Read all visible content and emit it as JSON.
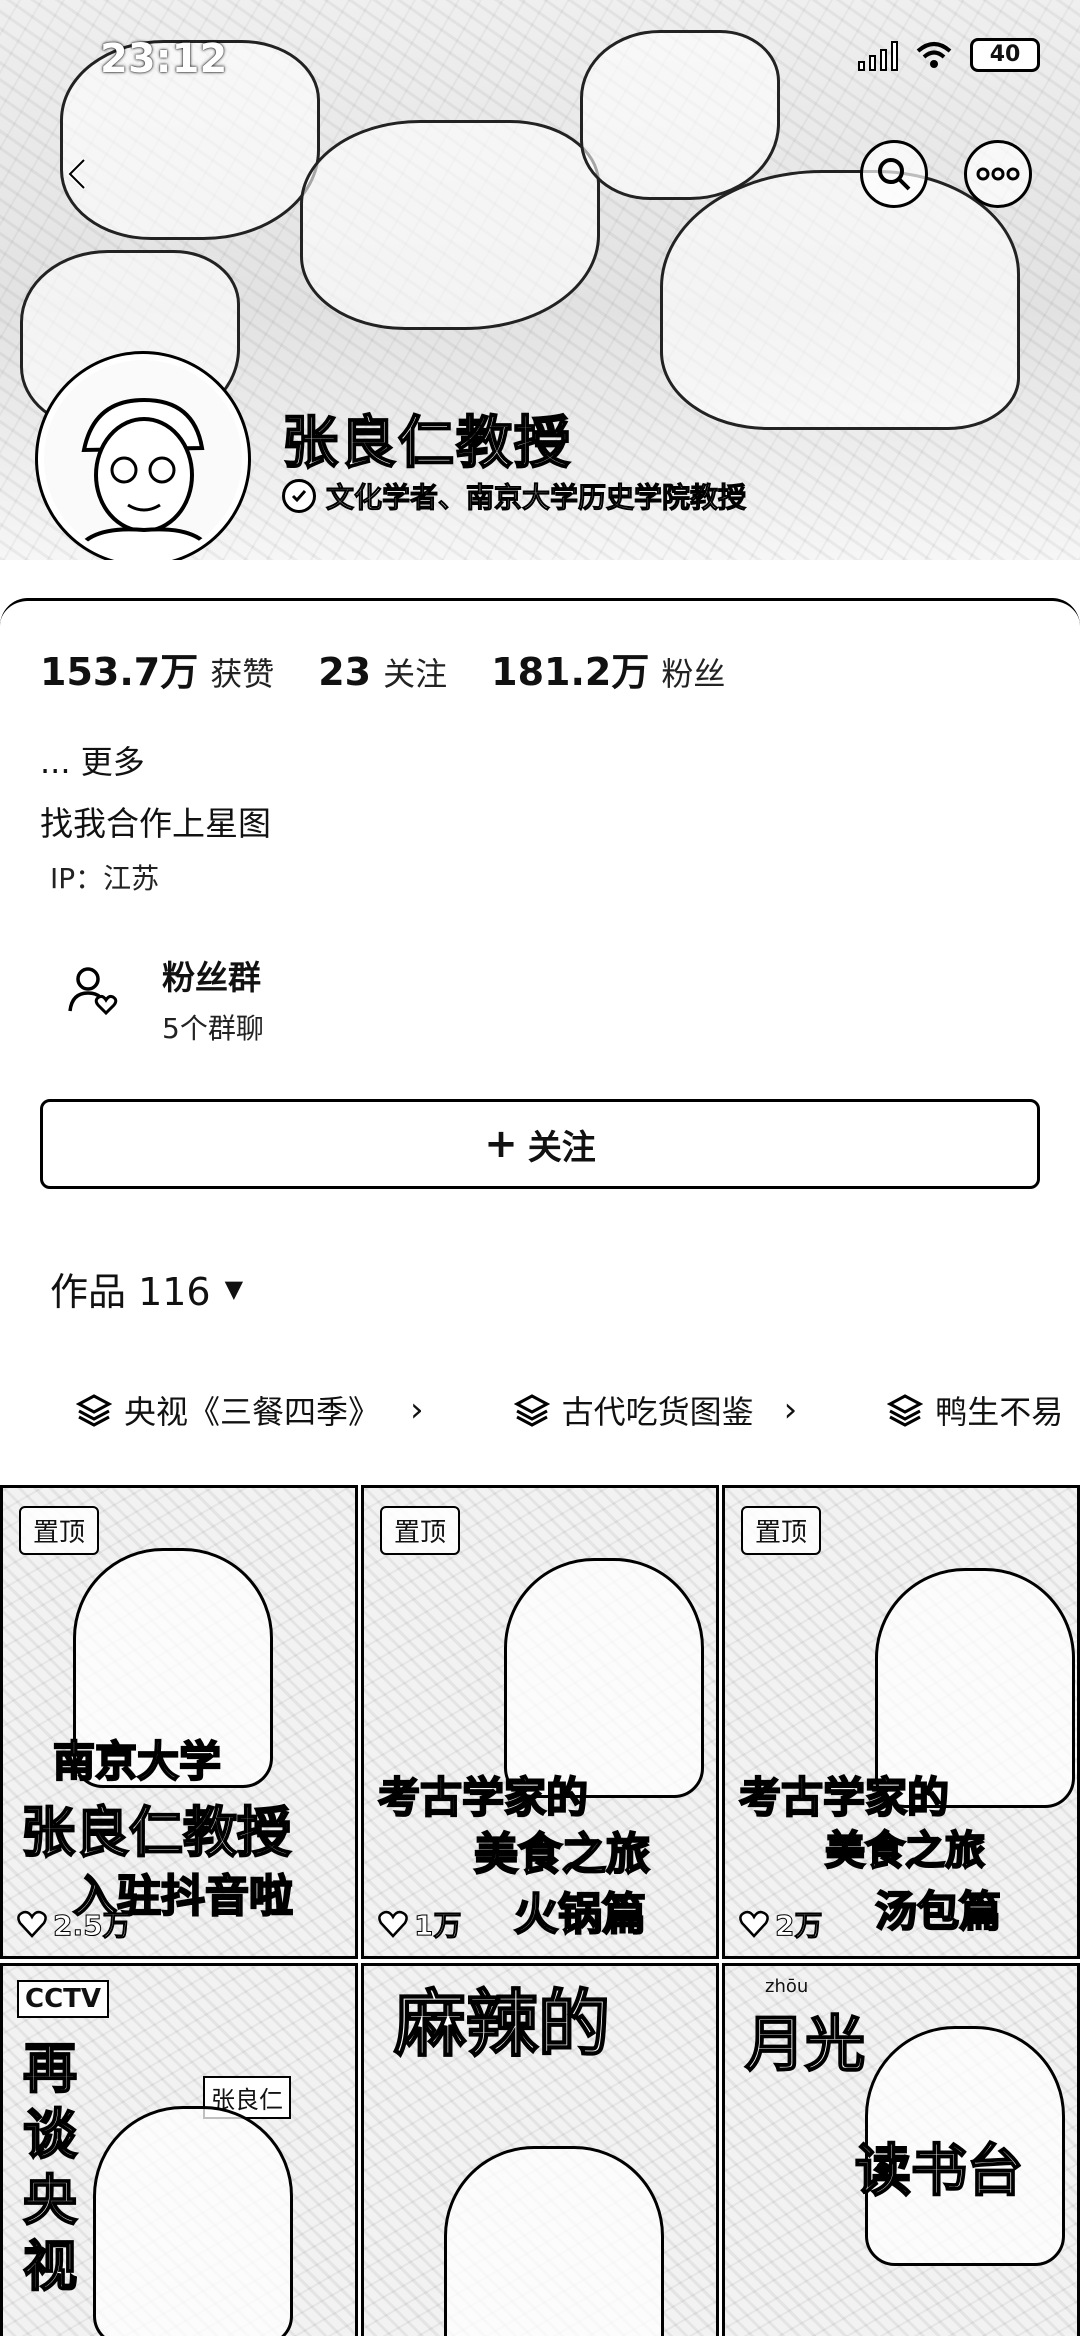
{
  "status_bar": {
    "time": "23:12",
    "battery": "40"
  },
  "profile": {
    "name": "张良仁教授",
    "verification": "文化学者、南京大学历史学院教授",
    "stats": [
      {
        "value": "153.7万",
        "label": "获赞"
      },
      {
        "value": "23",
        "label": "关注"
      },
      {
        "value": "181.2万",
        "label": "粉丝"
      }
    ],
    "more": "... 更多",
    "bio": "找我合作上星图",
    "ip": "IP：江苏"
  },
  "fan_group": {
    "title": "粉丝群",
    "subtitle": "5个群聊"
  },
  "follow_button": {
    "label": "关注"
  },
  "works": {
    "label": "作品 116",
    "caret": "▼"
  },
  "collections": [
    {
      "label": "央视《三餐四季》"
    },
    {
      "label": "古代吃货图鉴"
    },
    {
      "label": "鸭生不易"
    }
  ],
  "videos": [
    {
      "pinned": "置顶",
      "line1": "南京大学",
      "line2": "张良仁教授",
      "line3": "入驻抖音啦",
      "likes": "2.5万"
    },
    {
      "pinned": "置顶",
      "line1": "考古学家的",
      "line2": "美食之旅",
      "line3": "火锅篇",
      "likes": "1万"
    },
    {
      "pinned": "置顶",
      "line1": "考古学家的",
      "line2": "美食之旅",
      "line3": "汤包篇",
      "likes": "2万"
    },
    {
      "top_left": "CCTV",
      "vertical": "再谈央视",
      "label": "张良仁"
    },
    {
      "vertical": "麻辣的"
    },
    {
      "line1": "月光",
      "line2": "读书台",
      "pinyin": "zhōu"
    }
  ],
  "colors": {
    "text": "#111111",
    "border": "#000000",
    "background": "#ffffff"
  },
  "icons": [
    "back-icon",
    "search-icon",
    "more-icon",
    "verified-icon",
    "fans-group-icon",
    "layers-icon",
    "chevron-right-icon",
    "heart-icon",
    "plus-icon"
  ]
}
